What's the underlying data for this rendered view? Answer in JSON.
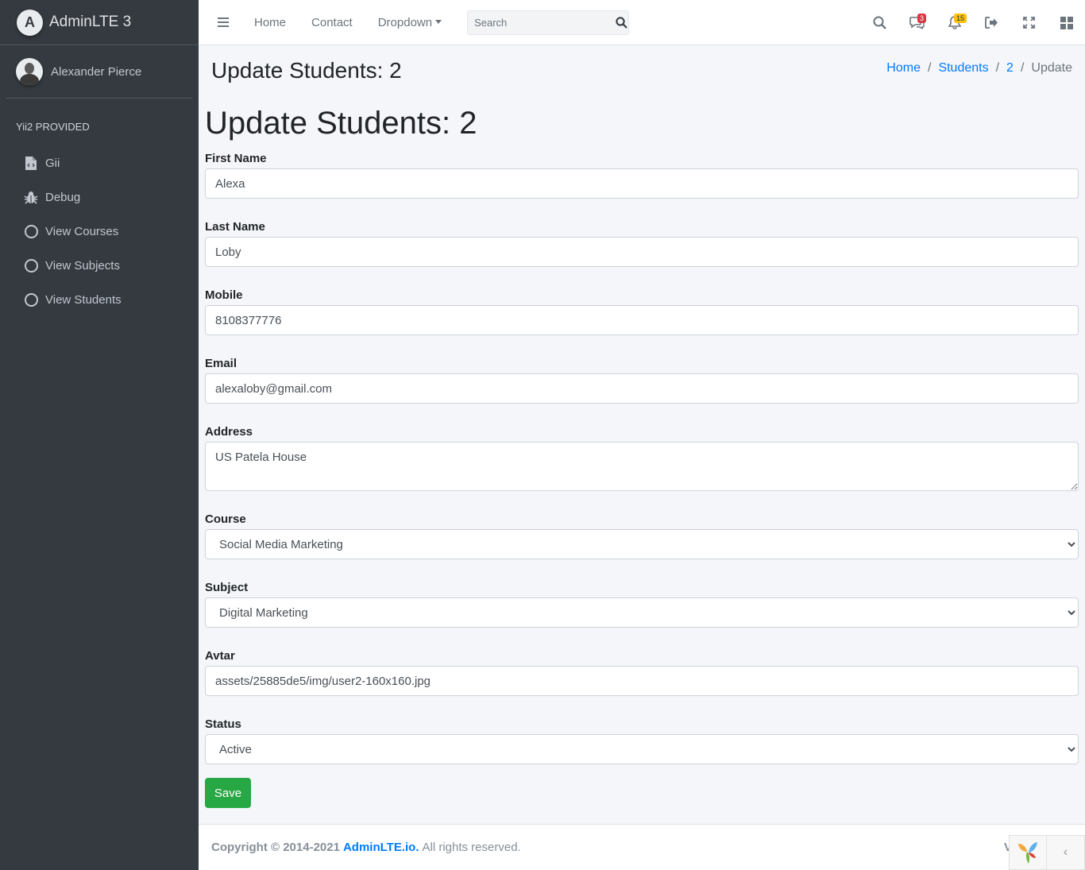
{
  "brand": {
    "name": "AdminLTE 3",
    "logo_letter": "A"
  },
  "user": {
    "name": "Alexander Pierce"
  },
  "sidebar": {
    "header": "Yii2 PROVIDED",
    "items": [
      {
        "label": "Gii",
        "icon": "file-code-icon"
      },
      {
        "label": "Debug",
        "icon": "bug-icon"
      },
      {
        "label": "View Courses",
        "icon": "circle-icon"
      },
      {
        "label": "View Subjects",
        "icon": "circle-icon"
      },
      {
        "label": "View Students",
        "icon": "circle-icon"
      }
    ]
  },
  "navbar": {
    "links": [
      "Home",
      "Contact",
      "Dropdown"
    ],
    "search_placeholder": "Search",
    "messages_count": "3",
    "notifications_count": "15"
  },
  "header": {
    "title": "Update Students: 2",
    "breadcrumb": [
      "Home",
      "Students",
      "2"
    ],
    "breadcrumb_active": "Update"
  },
  "form": {
    "title": "Update Students: 2",
    "first_name": {
      "label": "First Name",
      "value": "Alexa"
    },
    "last_name": {
      "label": "Last Name",
      "value": "Loby"
    },
    "mobile": {
      "label": "Mobile",
      "value": "8108377776"
    },
    "email": {
      "label": "Email",
      "value": "alexaloby@gmail.com"
    },
    "address": {
      "label": "Address",
      "value": "US Patela House"
    },
    "course": {
      "label": "Course",
      "value": "Social Media Marketing"
    },
    "subject": {
      "label": "Subject",
      "value": "Digital Marketing"
    },
    "avatar": {
      "label": "Avtar",
      "value": "assets/25885de5/img/user2-160x160.jpg"
    },
    "status": {
      "label": "Status",
      "value": "Active"
    },
    "save_label": "Save"
  },
  "footer": {
    "copyright": "Copyright © 2014-2021",
    "link": "AdminLTE.io.",
    "rights": "All rights reserved.",
    "version_fragment": "V"
  },
  "colors": {
    "sidebar_bg": "#343a40",
    "primary": "#007bff",
    "success": "#28a745",
    "danger": "#dc3545",
    "warning": "#ffc107"
  }
}
